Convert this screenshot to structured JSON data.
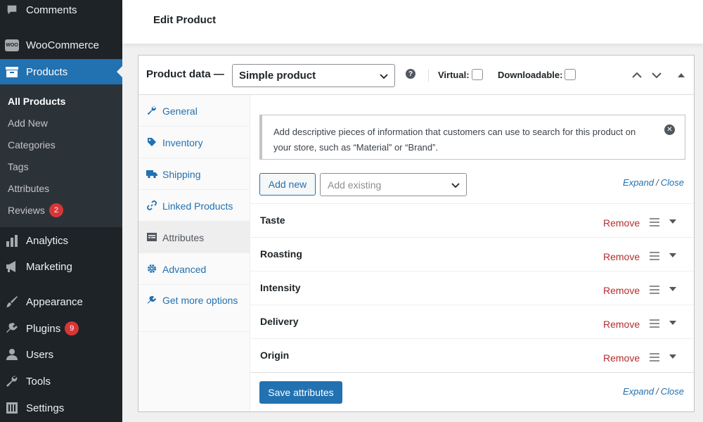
{
  "sidebar": {
    "menu": [
      {
        "label": "Comments",
        "icon": "comment-icon"
      },
      {
        "label": "WooCommerce",
        "icon": "woocommerce-icon"
      },
      {
        "label": "Products",
        "icon": "products-icon",
        "active": true
      },
      {
        "label": "Analytics",
        "icon": "analytics-icon"
      },
      {
        "label": "Marketing",
        "icon": "megaphone-icon"
      },
      {
        "label": "Appearance",
        "icon": "paintbrush-icon"
      },
      {
        "label": "Plugins",
        "icon": "plugin-icon",
        "badge": "9"
      },
      {
        "label": "Users",
        "icon": "users-icon"
      },
      {
        "label": "Tools",
        "icon": "wrench-icon"
      },
      {
        "label": "Settings",
        "icon": "settings-icon"
      }
    ],
    "woo_logo_text": "WOO",
    "submenu": [
      {
        "label": "All Products",
        "current": true
      },
      {
        "label": "Add New"
      },
      {
        "label": "Categories"
      },
      {
        "label": "Tags"
      },
      {
        "label": "Attributes"
      },
      {
        "label": "Reviews",
        "badge": "2"
      }
    ]
  },
  "header": {
    "title": "Edit Product"
  },
  "product_data": {
    "title": "Product data —",
    "product_type": "Simple product",
    "help_glyph": "?",
    "virtual_label": "Virtual:",
    "downloadable_label": "Downloadable:",
    "virtual_checked": false,
    "downloadable_checked": false
  },
  "tabs": [
    {
      "label": "General",
      "icon": "wrench-icon"
    },
    {
      "label": "Inventory",
      "icon": "tag-icon"
    },
    {
      "label": "Shipping",
      "icon": "truck-icon"
    },
    {
      "label": "Linked Products",
      "icon": "link-icon"
    },
    {
      "label": "Attributes",
      "icon": "list-view-icon",
      "active": true
    },
    {
      "label": "Advanced",
      "icon": "gear-icon"
    },
    {
      "label": "Get more options",
      "icon": "plugin-icon"
    }
  ],
  "attributes_panel": {
    "notice": "Add descriptive pieces of information that customers can use to search for this product on your store, such as “Material” or “Brand”.",
    "close_glyph": "✕",
    "add_new_label": "Add new",
    "add_existing_placeholder": "Add existing",
    "expand_label": "Expand",
    "slash": "/",
    "close_label": "Close",
    "attributes": [
      {
        "name": "Taste",
        "remove_label": "Remove"
      },
      {
        "name": "Roasting",
        "remove_label": "Remove"
      },
      {
        "name": "Intensity",
        "remove_label": "Remove"
      },
      {
        "name": "Delivery",
        "remove_label": "Remove"
      },
      {
        "name": "Origin",
        "remove_label": "Remove"
      }
    ],
    "save_label": "Save attributes"
  },
  "colors": {
    "admin_dark": "#1d2327",
    "admin_blue": "#2271b1",
    "remove_red": "#b32d2e",
    "badge_red": "#d63638"
  }
}
